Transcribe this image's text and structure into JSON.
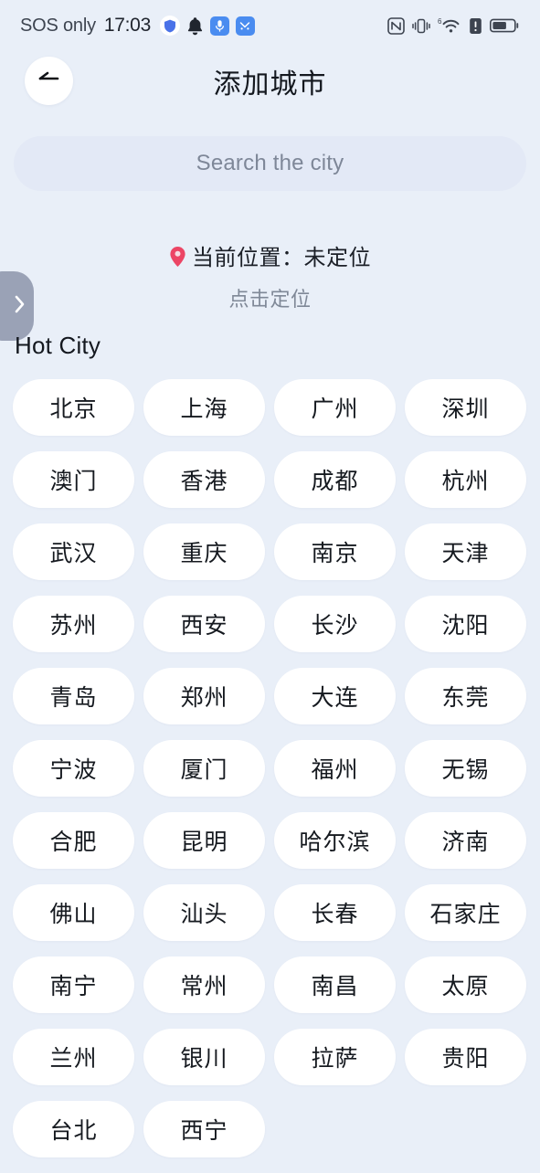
{
  "status_bar": {
    "carrier": "SOS only",
    "time": "17:03",
    "left_icons": [
      "shield-icon",
      "bell-icon",
      "microphone-icon",
      "app-icon"
    ],
    "right_icons": [
      "nfc-icon",
      "vibrate-icon",
      "wifi-6-icon",
      "sim-alert-icon",
      "battery-icon"
    ],
    "wifi_label": "6"
  },
  "header": {
    "title": "添加城市",
    "back_label": "back-arrow"
  },
  "search": {
    "placeholder": "Search the city",
    "value": ""
  },
  "location": {
    "label": "当前位置：未定位",
    "locate_link": "点击定位",
    "pin_color": "#ec4565"
  },
  "side_handle": {
    "icon": "chevron-right-icon",
    "color": "#9aa2b6"
  },
  "hot_city": {
    "section_title": "Hot City",
    "cities": [
      "北京",
      "上海",
      "广州",
      "深圳",
      "澳门",
      "香港",
      "成都",
      "杭州",
      "武汉",
      "重庆",
      "南京",
      "天津",
      "苏州",
      "西安",
      "长沙",
      "沈阳",
      "青岛",
      "郑州",
      "大连",
      "东莞",
      "宁波",
      "厦门",
      "福州",
      "无锡",
      "合肥",
      "昆明",
      "哈尔滨",
      "济南",
      "佛山",
      "汕头",
      "长春",
      "石家庄",
      "南宁",
      "常州",
      "南昌",
      "太原",
      "兰州",
      "银川",
      "拉萨",
      "贵阳",
      "台北",
      "西宁"
    ]
  },
  "theme": {
    "background": "#e9eff8",
    "chip_background": "#ffffff",
    "search_background": "#e3e9f6",
    "text_primary": "#15191f",
    "text_muted": "#7f8897"
  }
}
